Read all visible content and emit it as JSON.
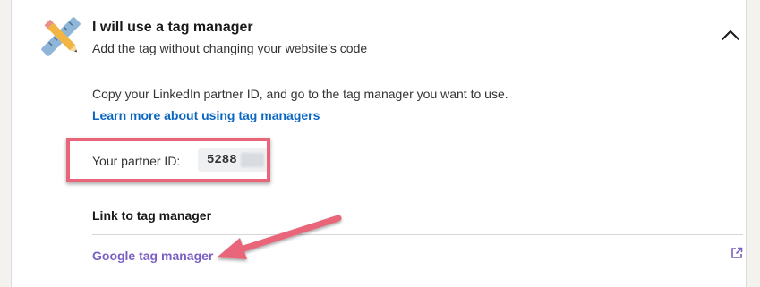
{
  "header": {
    "title": "I will use a tag manager",
    "subtitle": "Add the tag without changing your website’s code",
    "hero_icon": "pencil-ruler-icon",
    "collapse_icon": "chevron-up-icon"
  },
  "body": {
    "intro": "Copy your LinkedIn partner ID, and go to the tag manager you want to use.",
    "learn_more_link": "Learn more about using tag managers",
    "partner_id_label": "Your partner ID:",
    "partner_id_value": "5288"
  },
  "link_section": {
    "heading": "Link to tag manager",
    "items": [
      {
        "label": "Google tag manager",
        "icon": "external-link-icon"
      }
    ]
  },
  "colors": {
    "link_blue": "#0a66c2",
    "link_purple": "#7a5fc4",
    "highlight": "#e8657a"
  }
}
